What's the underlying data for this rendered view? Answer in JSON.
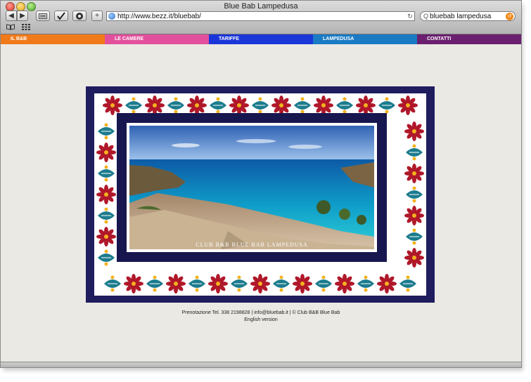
{
  "window": {
    "title": "Blue Bab Lampedusa"
  },
  "toolbar": {
    "back_icon": "◀",
    "forward_icon": "▶",
    "add_label": "+",
    "url": "http://www.bezz.it/bluebab/",
    "search_value": "bluebab lampedusa",
    "reload_icon": "↻"
  },
  "nav": {
    "items": [
      {
        "label": "IL B&B",
        "color": "#f07a1a"
      },
      {
        "label": "LE CAMERE",
        "color": "#e2509d"
      },
      {
        "label": "TARIFFE",
        "color": "#1b36d8"
      },
      {
        "label": "LAMPEDUSA",
        "color": "#1a7bc4"
      },
      {
        "label": "CONTATTI",
        "color": "#6b1f6f"
      }
    ]
  },
  "banner": {
    "caption": "CLUB B&B BLUE BAB LAMPEDUSA"
  },
  "footer": {
    "contact": "Prenotazione Tel. 338 2198828 | info@bluebab.it | © Club B&B Blue Bab",
    "english": "English version"
  },
  "colors": {
    "tile_red": "#b0182a",
    "tile_teal": "#1c7c8e",
    "tile_yellow": "#f4b21d",
    "frame_navy": "#1f1d5e"
  }
}
